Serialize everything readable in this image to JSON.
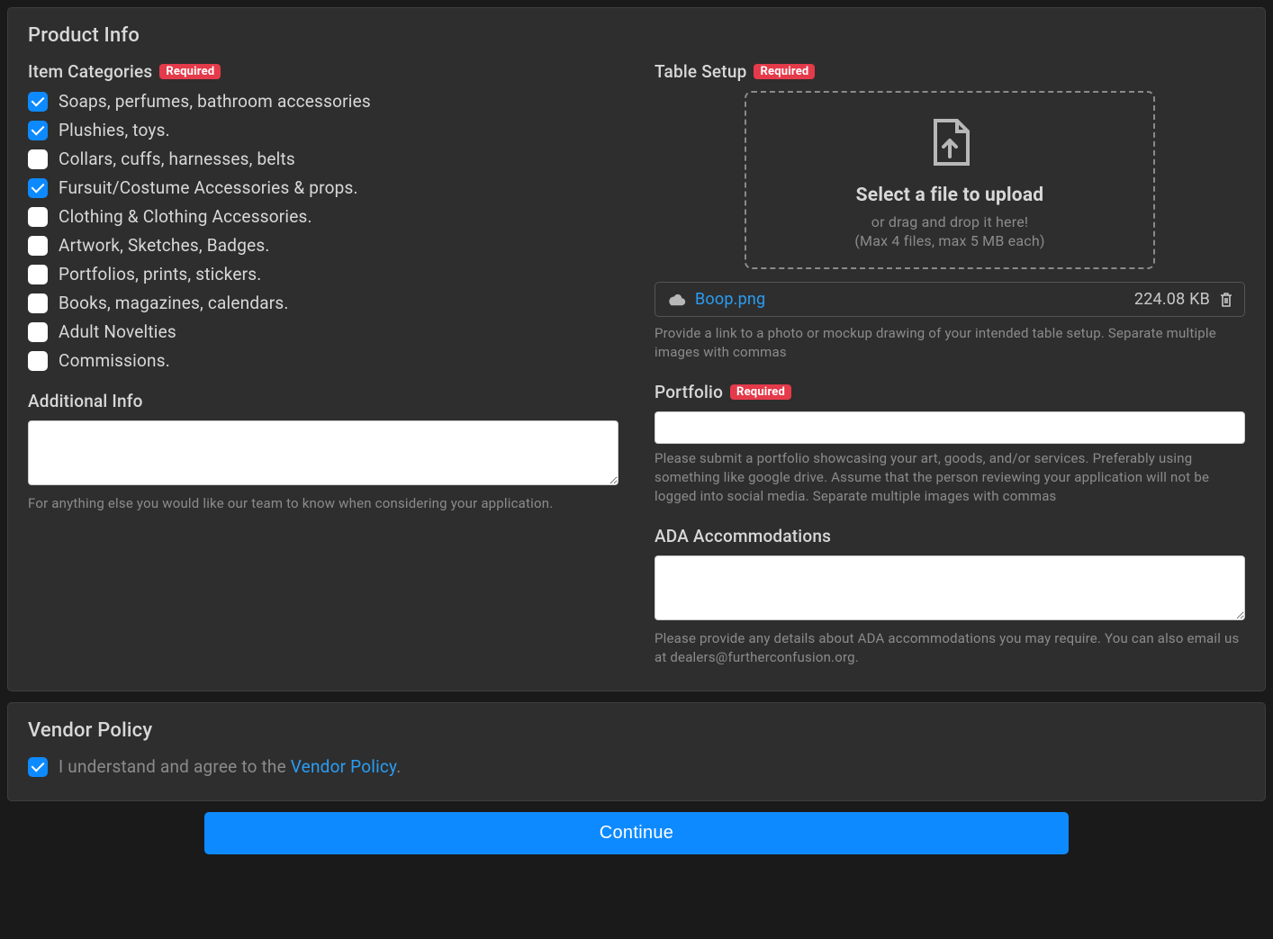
{
  "productInfo": {
    "heading": "Product Info",
    "categories": {
      "label": "Item Categories",
      "requiredBadge": "Required",
      "items": [
        {
          "label": "Soaps, perfumes, bathroom accessories",
          "checked": true
        },
        {
          "label": "Plushies, toys.",
          "checked": true
        },
        {
          "label": "Collars, cuffs, harnesses, belts",
          "checked": false
        },
        {
          "label": "Fursuit/Costume Accessories & props.",
          "checked": true
        },
        {
          "label": "Clothing & Clothing Accessories.",
          "checked": false
        },
        {
          "label": "Artwork, Sketches, Badges.",
          "checked": false
        },
        {
          "label": "Portfolios, prints, stickers.",
          "checked": false
        },
        {
          "label": "Books, magazines, calendars.",
          "checked": false
        },
        {
          "label": "Adult Novelties",
          "checked": false
        },
        {
          "label": "Commissions.",
          "checked": false
        }
      ]
    },
    "additionalInfo": {
      "label": "Additional Info",
      "value": "",
      "help": "For anything else you would like our team to know when considering your application."
    },
    "tableSetup": {
      "label": "Table Setup",
      "requiredBadge": "Required",
      "dropzone": {
        "title": "Select a file to upload",
        "subtitle": "or drag and drop it here!",
        "limit": "(Max 4 files, max 5 MB each)"
      },
      "files": [
        {
          "name": "Boop.png",
          "size": "224.08 KB"
        }
      ],
      "help": "Provide a link to a photo or mockup drawing of your intended table setup. Separate multiple images with commas"
    },
    "portfolio": {
      "label": "Portfolio",
      "requiredBadge": "Required",
      "value": "",
      "help": "Please submit a portfolio showcasing your art, goods, and/or services. Preferably using something like google drive. Assume that the person reviewing your application will not be logged into social media. Separate multiple images with commas"
    },
    "ada": {
      "label": "ADA Accommodations",
      "value": "",
      "help": "Please provide any details about ADA accommodations you may require. You can also email us at dealers@furtherconfusion.org."
    }
  },
  "vendorPolicy": {
    "heading": "Vendor Policy",
    "agreeChecked": true,
    "agreePrefix": "I understand and agree to the ",
    "agreeLink": "Vendor Policy",
    "agreeSuffix": "."
  },
  "actions": {
    "continue": "Continue"
  }
}
